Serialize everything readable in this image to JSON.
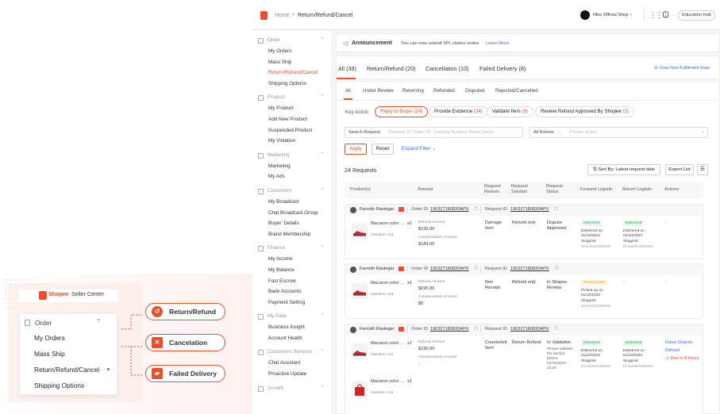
{
  "colors": {
    "accent": "#ee4d2d",
    "green": "#26aa55",
    "yellow": "#f0a400",
    "link": "#3b6ef0"
  },
  "topbar": {
    "breadcrumb_home": "Home",
    "breadcrumb_current": "Return/Refund/Cancel",
    "shop_name": "Nike Official Shop",
    "education_hub": "Education Hub"
  },
  "sidebar": {
    "sections": [
      {
        "title": "Order",
        "items": [
          "My Orders",
          "Mass Ship",
          "Return/Refund/Cancel",
          "Shipping Options"
        ]
      },
      {
        "title": "Product",
        "items": [
          "My Product",
          "Add New Product",
          "Suspended Product",
          "My Violation"
        ]
      },
      {
        "title": "Marketing",
        "items": [
          "Marketing",
          "My Ads"
        ]
      },
      {
        "title": "Customers",
        "items": [
          "My Broadcast",
          "Chat Broadcast Group",
          "Buyer' Details",
          "Brand Membership"
        ]
      },
      {
        "title": "Finance",
        "items": [
          "My Income",
          "My Balance",
          "Fast Escrow",
          "Bank Accounts",
          "Payment Setting"
        ]
      },
      {
        "title": "My Data",
        "items": [
          "Business Insight",
          "Account Health"
        ]
      },
      {
        "title": "Customers Services",
        "items": [
          "Chat Assistant",
          "Proactive Update"
        ]
      },
      {
        "title": "Growth",
        "items": []
      }
    ]
  },
  "announcement": {
    "label": "Announcement",
    "text": "You can now submit 3PL claims online",
    "link": "Learn More"
  },
  "tabs": {
    "items": [
      "All (38)",
      "Return/Refund (20)",
      "Cancellation (10)",
      "Failed Delivery (8)"
    ],
    "view_link": "View Non-Fulfilment Rate"
  },
  "subtabs": [
    "All",
    "Under Review",
    "Returning",
    "Refunded",
    "Disputed",
    "Rejected/Cancelled"
  ],
  "key_action": {
    "label": "Key Action",
    "chips": [
      {
        "label": "Reply to Buyer",
        "count": "(24)"
      },
      {
        "label": "Provide Evidence",
        "count": "(24)"
      },
      {
        "label": "Validate Item",
        "count": "(8)"
      },
      {
        "label": "Review Refund Approved By Shopee",
        "count": "(2)"
      }
    ]
  },
  "search": {
    "label": "Search Request",
    "placeholder": "Request ID, Order ID, Tracking Number, Buyer Name",
    "actions_label": "All Actions",
    "actions_placeholder": "Please Select",
    "apply": "Apply",
    "reset": "Reset",
    "expand": "Expand Filter"
  },
  "list": {
    "count": "24 Requests",
    "sort": "Sort By: Latest request date",
    "export": "Export List"
  },
  "columns": [
    "Product(s)",
    "Amount",
    "Request Reason",
    "Request Solution",
    "Request Status",
    "Forward Logistic",
    "Return Logistic",
    "Actions"
  ],
  "orders": [
    {
      "buyer": "Farrokh Rastegar",
      "order_label": "Order ID",
      "order_id": "190327180820APX",
      "request_label": "Request ID",
      "request_id": "190327180820APX",
      "products": [
        {
          "name": "Macaron color match...",
          "variation": "Variation: red",
          "qty": "x1"
        }
      ],
      "refund_label": "Refund Amount",
      "refund_amount": "$195.00",
      "comp_label": "Compensation Amount",
      "comp_amount": "$189.00",
      "reason": "Damage Item",
      "solution": "Refund only",
      "status": "Dispute Approved",
      "status_note": "",
      "fwd": {
        "badge": "Delivered",
        "date": "Delivered on 01/10/2023",
        "loc": "Singpost",
        "trk": "RA151521563SG"
      },
      "ret": {
        "badge": "Delivered",
        "date": "Delivered on 01/10/2023",
        "loc": "Singpost",
        "trk": "RA151521563SG"
      },
      "actions": [
        "-"
      ]
    },
    {
      "buyer": "Farrokh Rastegar",
      "order_label": "Order ID",
      "order_id": "190327180820APX",
      "request_label": "Request ID",
      "request_id": "190327180820APX",
      "products": [
        {
          "name": "Macaron color match...",
          "variation": "Variation: red",
          "qty": "x1"
        }
      ],
      "refund_label": "Refund Amount",
      "refund_amount": "$195.00",
      "comp_label": "Compensation Amount",
      "comp_amount": "$0",
      "reason": "Non Receipt",
      "solution": "Refund only",
      "status": "In Shopee Review",
      "status_note": "",
      "fwd": {
        "badge": "Pickup Done",
        "date": "Picked up on 01/10/2023",
        "loc": "Singpost",
        "trk": "RA151521563SG"
      },
      "ret": {
        "badge": "",
        "date": "-",
        "loc": "",
        "trk": ""
      },
      "actions": [
        "-"
      ]
    },
    {
      "buyer": "Farrokh Rastegar",
      "order_label": "Order ID",
      "order_id": "190327180820APX",
      "request_label": "Request ID",
      "request_id": "190327180820APX",
      "products": [
        {
          "name": "Macaron color match...",
          "variation": "Variation: red",
          "qty": "x1"
        },
        {
          "name": "Macaron color match...",
          "variation": "Variation: red",
          "qty": "x1"
        }
      ],
      "refund_label": "Refund Amount",
      "refund_amount": "$195.00",
      "comp_label": "Compensation Amount",
      "comp_amount": "-",
      "reason": "Counterfeit Item",
      "solution": "Return Refund",
      "status": "In Validation",
      "status_note": "Please validate the item(s) before 01/10/2023 14:30",
      "fwd": {
        "badge": "Delivered",
        "date": "Delivered on 01/10/2023",
        "loc": "Singpost",
        "trk": "RA151521563SG"
      },
      "ret": {
        "badge": "Delivered",
        "date": "Delivered on 01/10/2023",
        "loc": "Singpost",
        "trk": "RA151521563SG"
      },
      "actions": [
        "Raise Dispute",
        "Refund",
        "Due in 8 hours"
      ]
    }
  ],
  "promo": {
    "brand": "Shopee",
    "brand_suffix": "Seller Center",
    "menu_title": "Order",
    "menu_items": [
      "My Orders",
      "Mass Ship",
      "Return/Refund/Cancel",
      "Shipping Options"
    ],
    "pills": [
      "Return/Refund",
      "Cancelation",
      "Failed Delivery"
    ]
  }
}
